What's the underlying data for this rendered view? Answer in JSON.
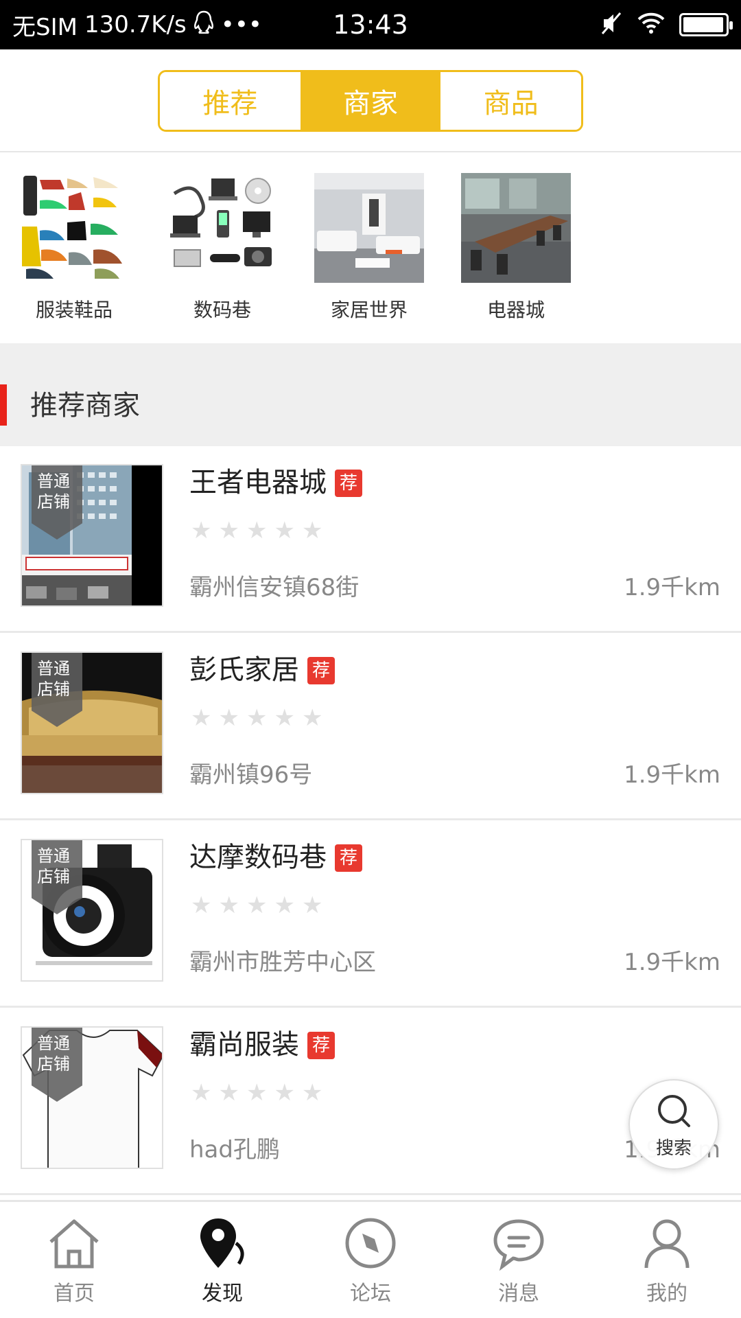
{
  "status_bar": {
    "carrier": "无SIM",
    "speed": "130.7K/s",
    "more": "•••",
    "time": "13:43"
  },
  "header": {
    "tabs": [
      {
        "label": "推荐",
        "active": false
      },
      {
        "label": "商家",
        "active": true
      },
      {
        "label": "商品",
        "active": false
      }
    ]
  },
  "categories": [
    {
      "label": "服装鞋品",
      "icon": "shoes-image"
    },
    {
      "label": "数码巷",
      "icon": "digital-devices-image"
    },
    {
      "label": "家居世界",
      "icon": "living-room-image"
    },
    {
      "label": "电器城",
      "icon": "meeting-room-image"
    }
  ],
  "section": {
    "title": "推荐商家"
  },
  "shops": [
    {
      "name": "王者电器城",
      "badge": "荐",
      "shop_type": "普通店铺",
      "rating": 0,
      "address": "霸州信安镇68街",
      "distance": "1.9千km"
    },
    {
      "name": "彭氏家居",
      "badge": "荐",
      "shop_type": "普通店铺",
      "rating": 0,
      "address": "霸州镇96号",
      "distance": "1.9千km"
    },
    {
      "name": "达摩数码巷",
      "badge": "荐",
      "shop_type": "普通店铺",
      "rating": 0,
      "address": "霸州市胜芳中心区",
      "distance": "1.9千km"
    },
    {
      "name": "霸尚服装",
      "badge": "荐",
      "shop_type": "普通店铺",
      "rating": 0,
      "address": "had孔鹏",
      "distance": "1.9千km"
    }
  ],
  "search_fab": {
    "label": "搜索"
  },
  "bottom_nav": [
    {
      "label": "首页",
      "icon": "home-icon",
      "active": false
    },
    {
      "label": "发现",
      "icon": "location-icon",
      "active": true
    },
    {
      "label": "论坛",
      "icon": "compass-icon",
      "active": false
    },
    {
      "label": "消息",
      "icon": "message-icon",
      "active": false
    },
    {
      "label": "我的",
      "icon": "user-icon",
      "active": false
    }
  ],
  "colors": {
    "accent": "#f0bd1b",
    "badge": "#e8392f",
    "section_bar": "#e8231a"
  }
}
